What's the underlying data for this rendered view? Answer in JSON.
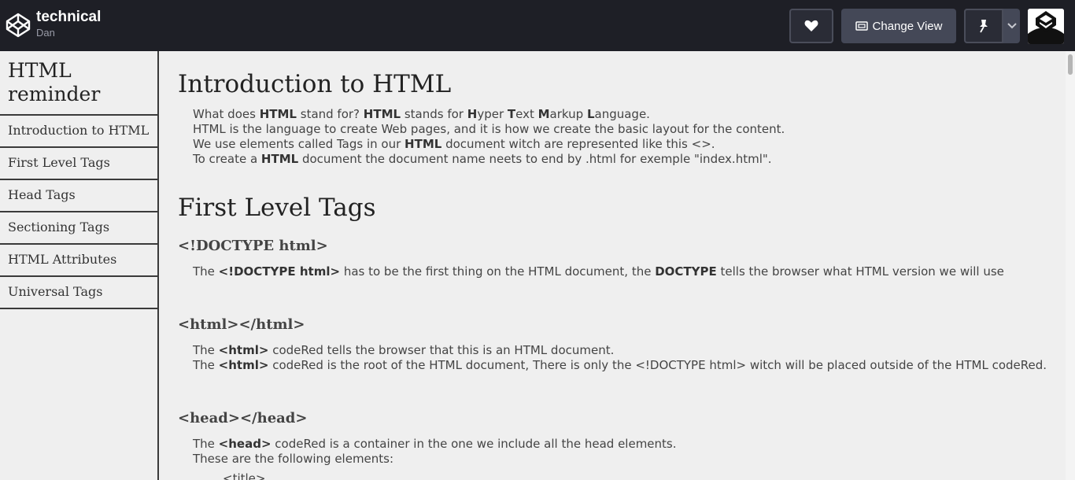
{
  "header": {
    "pen_title": "technical",
    "author": "Dan",
    "change_view_label": "Change View"
  },
  "icons": {
    "logo": "codepen-logo-icon",
    "heart": "heart-icon",
    "view": "change-view-icon",
    "pin": "pin-icon",
    "caret": "chevron-down-icon"
  },
  "sidebar": {
    "title": "HTML reminder",
    "items": [
      {
        "label": "Introduction to HTML"
      },
      {
        "label": "First Level Tags"
      },
      {
        "label": "Head Tags"
      },
      {
        "label": "Sectioning Tags"
      },
      {
        "label": "HTML Attributes"
      },
      {
        "label": "Universal Tags"
      }
    ]
  },
  "main": {
    "intro": {
      "title": "Introduction to HTML",
      "line1_a": "What does ",
      "line1_b": "HTML",
      "line1_c": " stand for? ",
      "line1_d": "HTML",
      "line1_e": " stands for ",
      "h": "H",
      "yper": "yper ",
      "t": "T",
      "ext": "ext ",
      "m": "M",
      "arkup": "arkup ",
      "l": "L",
      "anguage": "anguage.",
      "line2": "HTML is the language to create Web pages, and it is how we create the basic layout for the content.",
      "line3_a": "We use elements called Tags in our ",
      "line3_b": "HTML",
      "line3_c": " document witch are represented like this <>.",
      "line4_a": "To create a ",
      "line4_b": "HTML",
      "line4_c": " document the document name neets to end by .html for exemple \"index.html\"."
    },
    "first_level": {
      "title": "First Level Tags",
      "doctype_heading": "<!DOCTYPE html>",
      "doctype_a": "The ",
      "doctype_b": "<!DOCTYPE html>",
      "doctype_c": " has to be the first thing on the HTML document, the ",
      "doctype_d": "DOCTYPE",
      "doctype_e": " tells the browser what HTML version we will use",
      "html_heading": "<html></html>",
      "html1_a": "The ",
      "html1_b": "<html>",
      "html1_c": " codeRed tells the browser that this is an HTML document.",
      "html2_a": "The ",
      "html2_b": "<html>",
      "html2_c": " codeRed is the root of the HTML document, There is only the <!DOCTYPE html> witch will be placed outside of the HTML codeRed.",
      "head_heading": "<head></head>",
      "head1_a": "The ",
      "head1_b": "<head>",
      "head1_c": " codeRed is a container in the one we include all the head elements.",
      "head2": "These are the following elements:",
      "head_item1": "<title>"
    }
  },
  "colors": {
    "topbar": "#1e1f26",
    "button": "#444857",
    "background": "#efefef"
  }
}
